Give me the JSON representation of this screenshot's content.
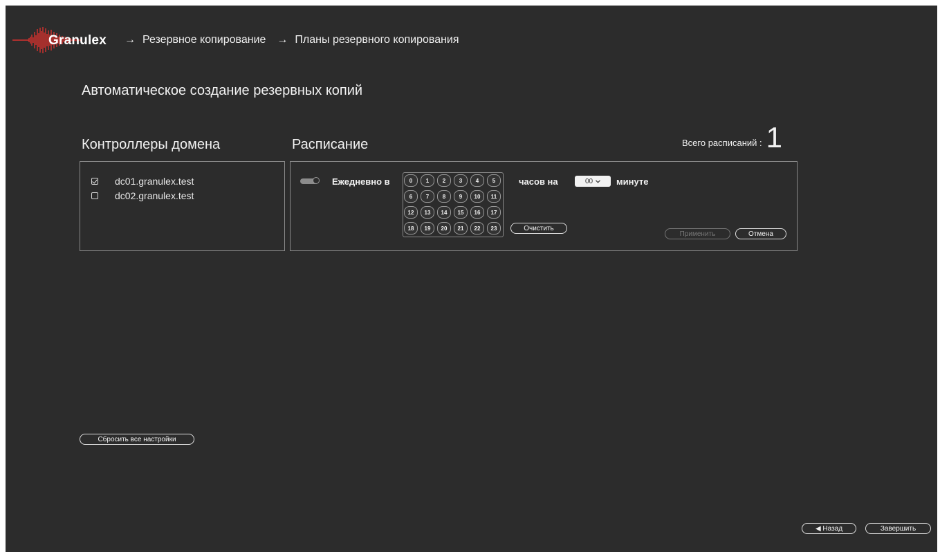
{
  "header": {
    "logo_text": "Granulex",
    "breadcrumb": [
      "Резервное копирование",
      "Планы резервного копирования"
    ],
    "arrow": "→"
  },
  "page_title": "Автоматическое создание резервных копий",
  "domain_controllers": {
    "title": "Контроллеры домена",
    "items": [
      {
        "name": "dc01.granulex.test",
        "checked": true
      },
      {
        "name": "dc02.granulex.test",
        "checked": false
      }
    ]
  },
  "schedule": {
    "title": "Расписание",
    "total_label": "Всего расписаний :",
    "total_count": "1",
    "daily_label": "Ежедневно в",
    "hours": [
      "0",
      "1",
      "2",
      "3",
      "4",
      "5",
      "6",
      "7",
      "8",
      "9",
      "10",
      "11",
      "12",
      "13",
      "14",
      "15",
      "16",
      "17",
      "18",
      "19",
      "20",
      "21",
      "22",
      "23"
    ],
    "hours_label": "часов на",
    "minute_value": "00",
    "minute_label": "минуте",
    "clear_label": "Очистить",
    "apply_label": "Применить",
    "cancel_label": "Отмена"
  },
  "reset_all_label": "Сбросить все настройки",
  "footer": {
    "back_label": "◀ Назад",
    "finish_label": "Завершить"
  },
  "colors": {
    "background": "#2c2c2c",
    "logo_accent": "#d8322e"
  }
}
